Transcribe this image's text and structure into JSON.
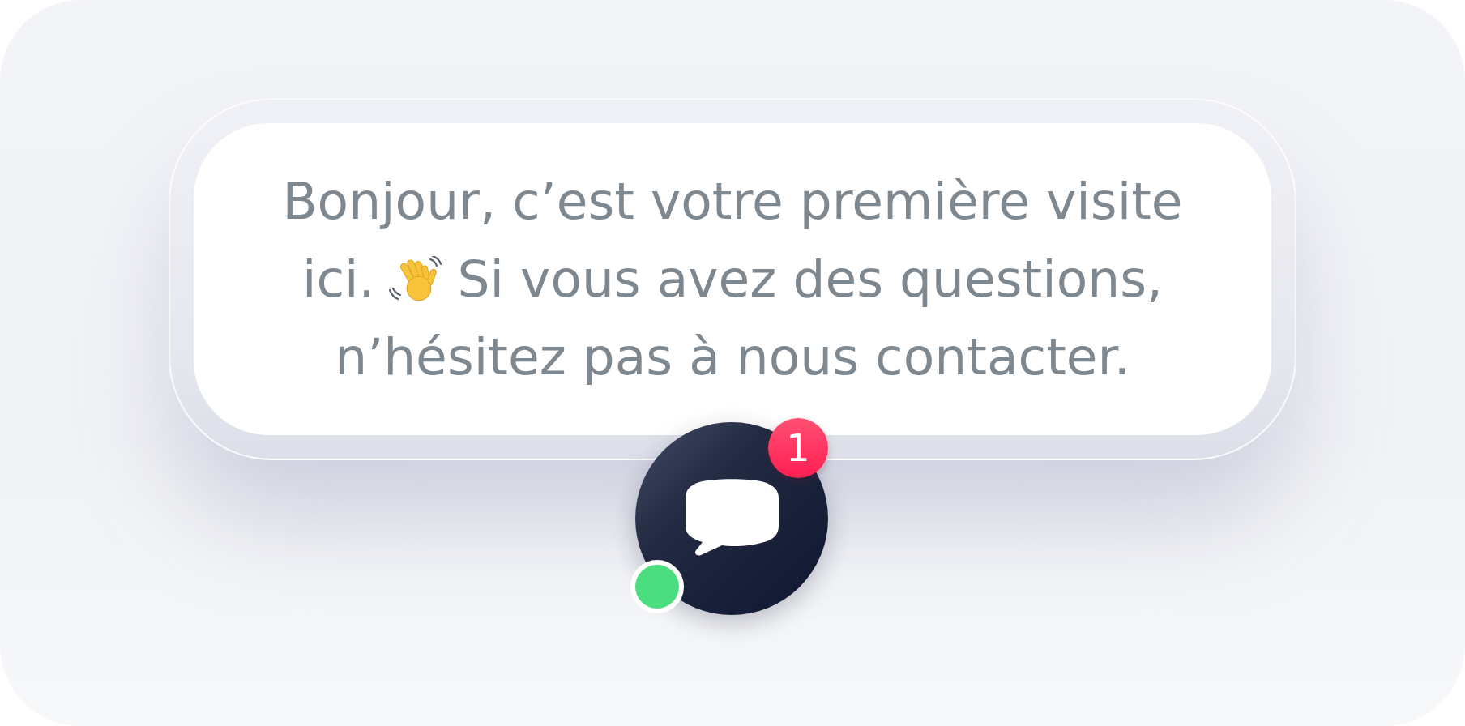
{
  "message": {
    "lines": [
      [
        {
          "kind": "text",
          "text": "Bonjour, c’est votre première visite"
        }
      ],
      [
        {
          "kind": "text",
          "text": "ici."
        },
        {
          "kind": "emoji"
        },
        {
          "kind": "text",
          "text": "Si vous avez des questions,"
        }
      ],
      [
        {
          "kind": "text",
          "text": "n’hésitez pas à nous contacter."
        }
      ]
    ]
  },
  "launcher": {
    "badge": "1",
    "online": true
  }
}
